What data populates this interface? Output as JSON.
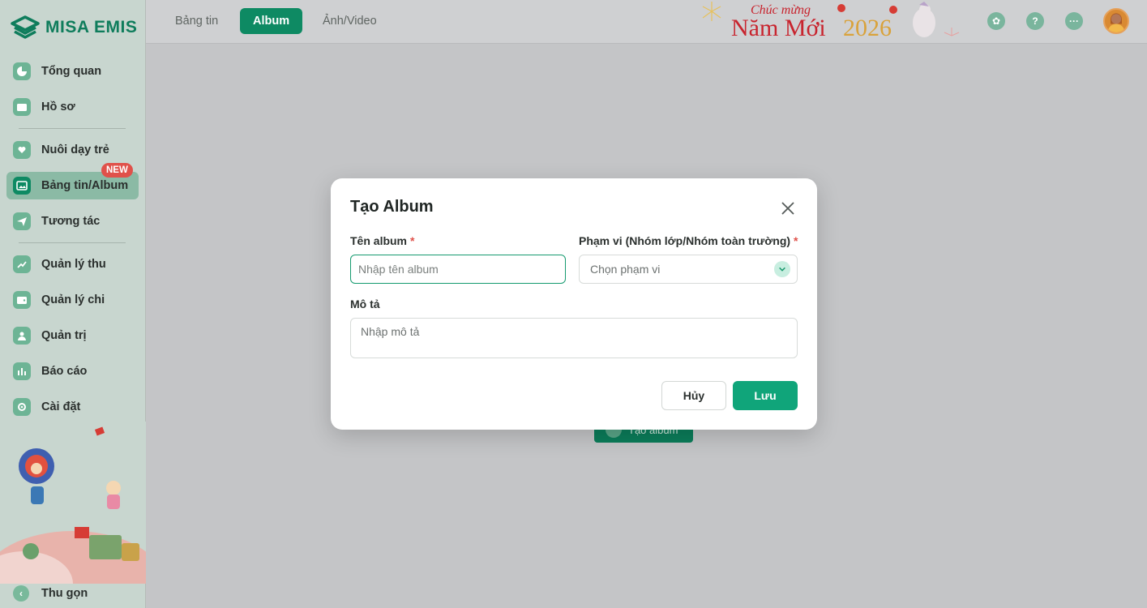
{
  "app": {
    "logo_text": "MISA EMIS"
  },
  "sidebar": {
    "items": [
      {
        "label": "Tổng quan",
        "icon": "pie-chart-icon"
      },
      {
        "label": "Hồ sơ",
        "icon": "folder-icon"
      },
      {
        "label": "Nuôi dạy trẻ",
        "icon": "home-heart-icon"
      },
      {
        "label": "Bảng tin/Album",
        "icon": "image-icon"
      },
      {
        "label": "Tương tác",
        "icon": "send-icon"
      },
      {
        "label": "Quản lý thu",
        "icon": "trend-icon"
      },
      {
        "label": "Quản lý chi",
        "icon": "wallet-icon"
      },
      {
        "label": "Quản trị",
        "icon": "admin-icon"
      },
      {
        "label": "Báo cáo",
        "icon": "bar-chart-icon"
      },
      {
        "label": "Cài đặt",
        "icon": "settings-icon"
      }
    ],
    "badge": "NEW",
    "collapse_label": "Thu gọn"
  },
  "header": {
    "tabs": [
      {
        "label": "Bảng tin",
        "active": false
      },
      {
        "label": "Album",
        "active": true
      },
      {
        "label": "Ảnh/Video",
        "active": false
      }
    ],
    "banner": {
      "line1": "Chúc mừng",
      "line2": "Năm Mới",
      "year": "2026"
    },
    "icons": [
      "flower-icon",
      "help-icon",
      "more-icon"
    ]
  },
  "background": {
    "create_album_label": "Tạo album"
  },
  "modal": {
    "title": "Tạo Album",
    "album_name_label": "Tên album",
    "album_name_placeholder": "Nhập tên album",
    "album_name_value": "",
    "scope_label": "Phạm vi (Nhóm lớp/Nhóm toàn trường)",
    "scope_placeholder": "Chọn phạm vi",
    "description_label": "Mô tả",
    "description_placeholder": "Nhập mô tả",
    "required_mark": "*",
    "cancel_label": "Hủy",
    "save_label": "Lưu"
  },
  "colors": {
    "brand": "#0e8a63",
    "save_button": "#10a57a",
    "required": "#e0514a",
    "badge": "#e0514a",
    "overlay": "#c4c5c7"
  }
}
